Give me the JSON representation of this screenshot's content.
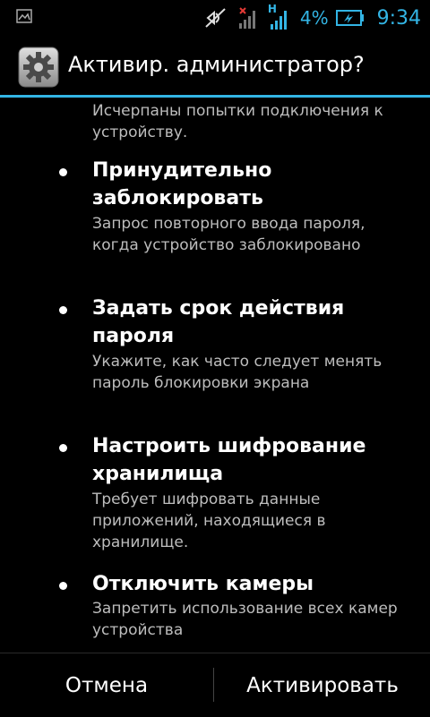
{
  "status_bar": {
    "notification_icon": "image-icon",
    "mute_icon": "vibrate-off-icon",
    "signal_icon": "signal-no-service-icon",
    "network_type": "H",
    "battery_percent": "4%",
    "battery_icon": "battery-charging-icon",
    "time": "9:34",
    "accent_color": "#33b5e5"
  },
  "dialog": {
    "title": "Активир. администратор?",
    "icon": "settings-gear-icon",
    "divider_color": "#33b5e5",
    "partial_description": "Исчерпаны попытки подключения к устройству.",
    "policies": [
      {
        "title": "Принудительно заблокировать",
        "description": "Запрос повторного ввода пароля, когда устройство заблокировано"
      },
      {
        "title": "Задать срок действия пароля",
        "description": "Укажите, как часто следует менять пароль блокировки экрана"
      },
      {
        "title": "Настроить шифрование хранилища",
        "description": "Требует шифровать данные приложений, находящиеся в хранилище."
      },
      {
        "title": "Отключить камеры",
        "description": "Запретить использование всех камер устройства"
      }
    ]
  },
  "buttons": {
    "cancel": "Отмена",
    "activate": "Активировать"
  }
}
